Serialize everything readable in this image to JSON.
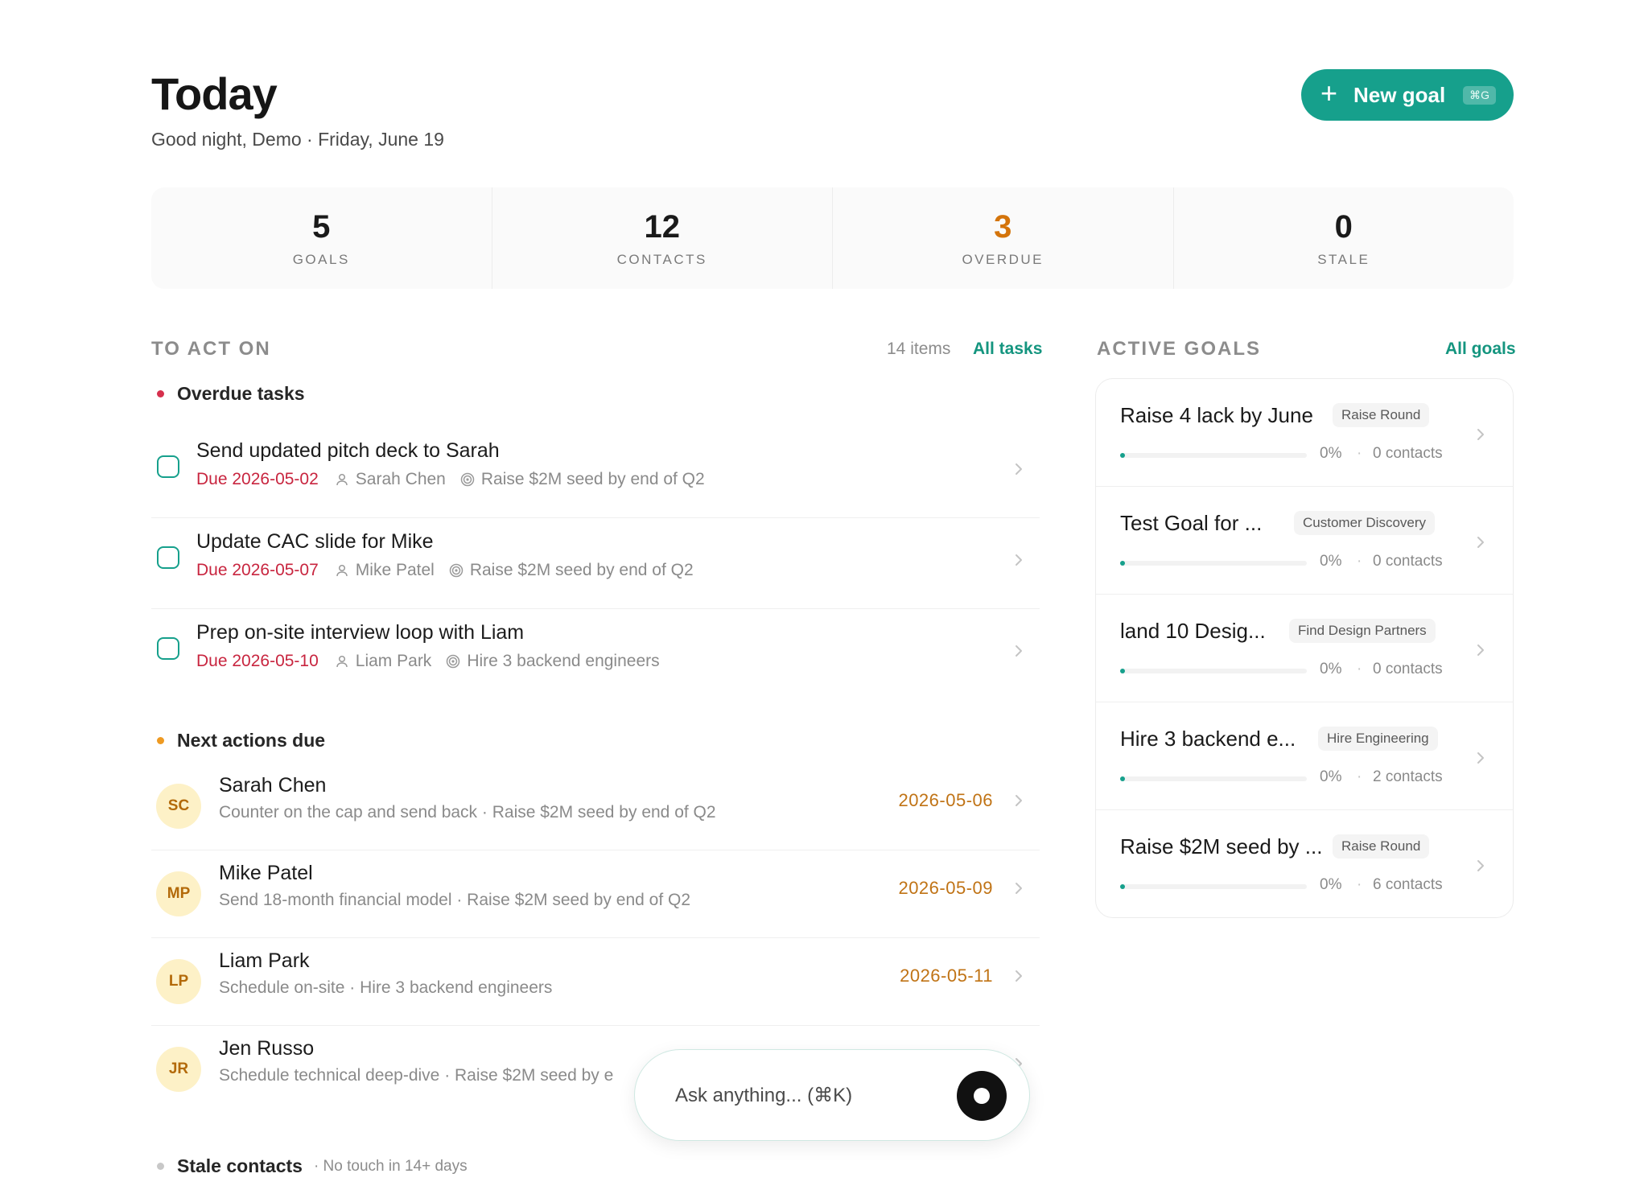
{
  "header": {
    "title": "Today",
    "subtitle": "Good night, Demo · Friday, June 19",
    "new_goal_label": "New goal",
    "new_goal_shortcut": "⌘G"
  },
  "stats": [
    {
      "value": "5",
      "label": "GOALS"
    },
    {
      "value": "12",
      "label": "CONTACTS"
    },
    {
      "value": "3",
      "label": "OVERDUE"
    },
    {
      "value": "0",
      "label": "STALE"
    }
  ],
  "to_act_on": {
    "title": "TO ACT ON",
    "count": "14 items",
    "link": "All tasks",
    "overdue_title": "Overdue tasks",
    "overdue": [
      {
        "title": "Send updated pitch deck to Sarah",
        "due": "Due 2026-05-02",
        "person": "Sarah Chen",
        "goal": "Raise $2M seed by end of Q2"
      },
      {
        "title": "Update CAC slide for Mike",
        "due": "Due 2026-05-07",
        "person": "Mike Patel",
        "goal": "Raise $2M seed by end of Q2"
      },
      {
        "title": "Prep on-site interview loop with Liam",
        "due": "Due 2026-05-10",
        "person": "Liam Park",
        "goal": "Hire 3 backend engineers"
      }
    ],
    "next_title": "Next actions due",
    "next": [
      {
        "initials": "SC",
        "name": "Sarah Chen",
        "desc": "Counter on the cap and send back · Raise $2M seed by end of Q2",
        "date": "2026-05-06"
      },
      {
        "initials": "MP",
        "name": "Mike Patel",
        "desc": "Send 18-month financial model · Raise $2M seed by end of Q2",
        "date": "2026-05-09"
      },
      {
        "initials": "LP",
        "name": "Liam Park",
        "desc": "Schedule on-site · Hire 3 backend engineers",
        "date": "2026-05-11"
      },
      {
        "initials": "JR",
        "name": "Jen Russo",
        "desc": "Schedule technical deep-dive · Raise $2M seed by e",
        "date": ""
      }
    ],
    "stale_title": "Stale contacts",
    "stale_note": "· No touch in 14+ days"
  },
  "active_goals": {
    "title": "ACTIVE GOALS",
    "link": "All goals",
    "items": [
      {
        "title": "Raise 4 lack by June",
        "tag": "Raise Round",
        "progress": 0.0,
        "pct": "0%",
        "contacts": "0 contacts"
      },
      {
        "title": "Test Goal for ...",
        "tag": "Customer Discovery",
        "progress": 0.0,
        "pct": "0%",
        "contacts": "0 contacts"
      },
      {
        "title": "land 10 Desig...",
        "tag": "Find Design Partners",
        "progress": 0.0,
        "pct": "0%",
        "contacts": "0 contacts"
      },
      {
        "title": "Hire 3 backend e...",
        "tag": "Hire Engineering",
        "progress": 0.0,
        "pct": "0%",
        "contacts": "2 contacts"
      },
      {
        "title": "Raise $2M seed by ...",
        "tag": "Raise Round",
        "progress": 0.0,
        "pct": "0%",
        "contacts": "6 contacts"
      }
    ]
  },
  "ask": {
    "placeholder": "Ask anything... (⌘K)"
  },
  "colors": {
    "accent": "#16a08c",
    "overdue": "#c8253f",
    "warning": "#d4740b"
  }
}
